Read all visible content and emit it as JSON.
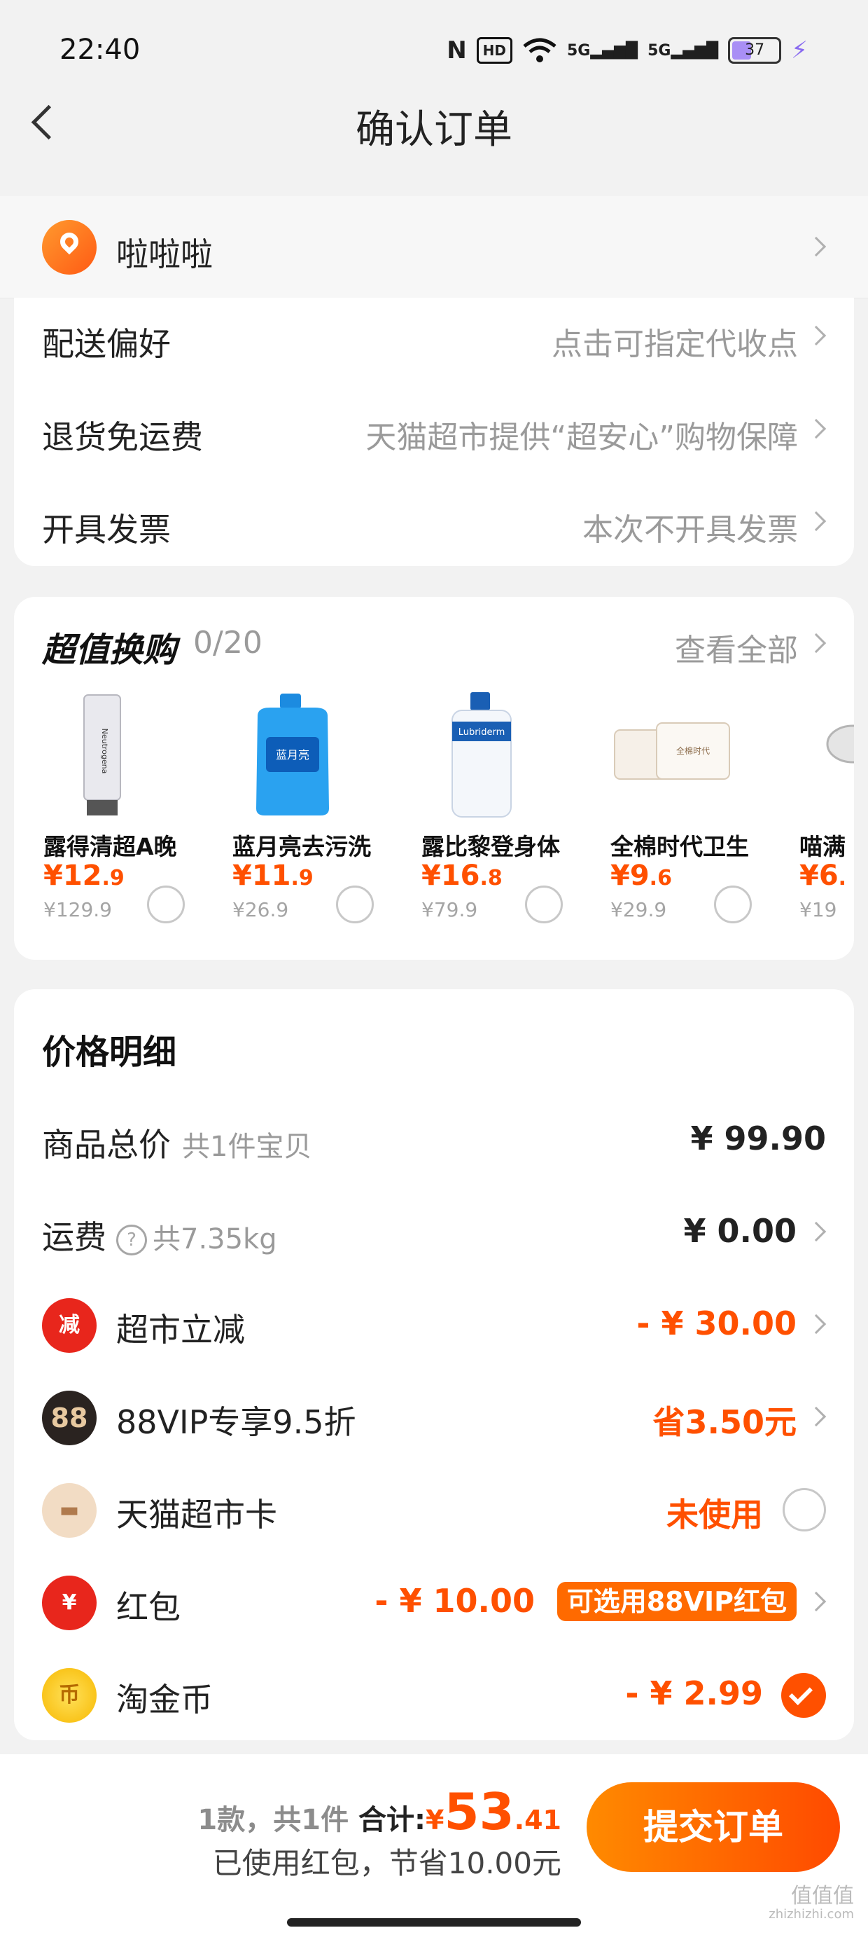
{
  "status": {
    "time": "22:40",
    "battery": "37",
    "hd": "HD",
    "net1": "5G",
    "net2": "5G"
  },
  "header": {
    "title": "确认订单"
  },
  "address": {
    "name": "啦啦啦"
  },
  "delivery": {
    "rows": [
      {
        "label": "配送偏好",
        "value": "点击可指定代收点"
      },
      {
        "label": "退货免运费",
        "value": "天猫超市提供“超安心”购物保障"
      },
      {
        "label": "开具发票",
        "value": "本次不开具发票"
      }
    ]
  },
  "exchange": {
    "title": "超值换购",
    "count": "0/20",
    "view_all": "查看全部",
    "products": [
      {
        "name": "露得清超A晚",
        "price_int": "¥12",
        "price_dec": ".9",
        "orig": "¥129.9"
      },
      {
        "name": "蓝月亮去污洗",
        "price_int": "¥11",
        "price_dec": ".9",
        "orig": "¥26.9"
      },
      {
        "name": "露比黎登身体",
        "price_int": "¥16",
        "price_dec": ".8",
        "orig": "¥79.9"
      },
      {
        "name": "全棉时代卫生",
        "price_int": "¥9",
        "price_dec": ".6",
        "orig": "¥29.9"
      },
      {
        "name": "喵满",
        "price_int": "¥6",
        "price_dec": ".",
        "orig": "¥19"
      }
    ],
    "product_images": [
      "Neutrogena",
      "蓝月亮",
      "Lubriderm",
      "全棉时代",
      ""
    ]
  },
  "price_detail": {
    "title": "价格明细",
    "goods_total": {
      "label": "商品总价",
      "sub": "共1件宝贝",
      "amount": "¥ 99.90"
    },
    "shipping": {
      "label": "运费",
      "sub": "共7.35kg",
      "help": "?",
      "amount": "¥ 0.00"
    },
    "market_discount": {
      "label": "超市立减",
      "icon": "减",
      "amount": "- ¥ 30.00"
    },
    "vip": {
      "label": "88VIP专享9.5折",
      "icon": "88",
      "amount": "省3.50元"
    },
    "card": {
      "label": "天猫超市卡",
      "amount": "未使用"
    },
    "red_packet": {
      "label": "红包",
      "icon": "¥",
      "amount": "- ¥ 10.00",
      "tag": "可选用88VIP红包"
    },
    "coins": {
      "label": "淘金币",
      "icon": "币",
      "amount": "- ¥ 2.99"
    }
  },
  "bottom": {
    "count": "1款，共1件",
    "total_label": "合计:",
    "yen": "¥",
    "total_int": "53",
    "total_dec": ".41",
    "saving": "已使用红包，节省10.00元",
    "submit": "提交订单"
  },
  "watermark": {
    "text": "值值值",
    "url": "zhizhizhi.com"
  }
}
